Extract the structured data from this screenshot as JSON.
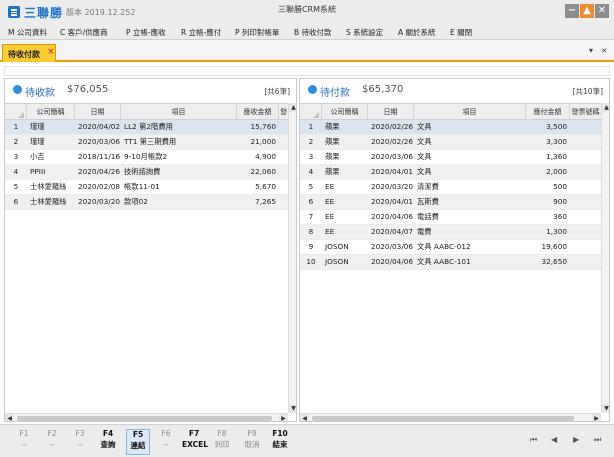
{
  "app": {
    "name": "三聯勝",
    "version": "版本 2019.12.252",
    "window_title": "三聯勝CRM系統"
  },
  "window_controls": {
    "minimize": "−",
    "maximize": "▲",
    "close": "✕"
  },
  "menu": [
    "M 公司資料",
    "C 客戶/供應商",
    "P 立帳-應收",
    "R 立帳-應付",
    "P 列印對帳單",
    "B 待收付款",
    "S 系統設定",
    "A 關於系統",
    "E 關閉"
  ],
  "tab": {
    "label": "待收付款",
    "close": "×"
  },
  "strip_controls": {
    "dropdown": "▾",
    "close": "×"
  },
  "receivable": {
    "title": "待收款",
    "amount": "$76,055",
    "count": "[共6筆]",
    "columns": [
      "公司簡稱",
      "日期",
      "項目",
      "應收金額",
      "發"
    ],
    "rows": [
      [
        "瑾瑾",
        "2020/04/02",
        "LL2 第2階費用",
        "15,760"
      ],
      [
        "瑾瑾",
        "2020/03/06",
        "TT1 第三期費用",
        "21,000"
      ],
      [
        "小吉",
        "2018/11/16",
        "9-10月帳款2",
        "4,900"
      ],
      [
        "PPIII",
        "2020/04/26",
        "技術諮詢費",
        "22,060"
      ],
      [
        "士林愛羅絲",
        "2020/02/08",
        "帳款11-01",
        "5,670"
      ],
      [
        "士林愛羅絲",
        "2020/03/20",
        "款項02",
        "7,265"
      ]
    ]
  },
  "payable": {
    "title": "待付款",
    "amount": "$65,370",
    "count": "[共10筆]",
    "columns": [
      "公司簡稱",
      "日期",
      "項目",
      "應付金額",
      "發票號碼"
    ],
    "rows": [
      [
        "蘋果",
        "2020/02/26",
        "文具",
        "3,500"
      ],
      [
        "蘋果",
        "2020/02/26",
        "文具",
        "3,300"
      ],
      [
        "蘋果",
        "2020/03/06",
        "文具",
        "1,360"
      ],
      [
        "蘋果",
        "2020/04/01",
        "文具",
        "2,000"
      ],
      [
        "EE",
        "2020/03/20",
        "清潔費",
        "500"
      ],
      [
        "EE",
        "2020/04/01",
        "瓦斯費",
        "900"
      ],
      [
        "EE",
        "2020/04/06",
        "電話費",
        "360"
      ],
      [
        "EE",
        "2020/04/07",
        "電費",
        "1,300"
      ],
      [
        "JOSON",
        "2020/03/06",
        "文具 AABC-012",
        "19,600"
      ],
      [
        "JOSON",
        "2020/04/06",
        "文具 AABC-101",
        "32,650"
      ]
    ]
  },
  "scroll_arrows": {
    "up": "▲",
    "down": "▼",
    "left": "◀",
    "right": "▶"
  },
  "fkeys": [
    {
      "key": "F1",
      "label": "--",
      "on": false
    },
    {
      "key": "F2",
      "label": "--",
      "on": false
    },
    {
      "key": "F3",
      "label": "--",
      "on": false
    },
    {
      "key": "F4",
      "label": "查詢",
      "on": true
    },
    {
      "key": "F5",
      "label": "連結",
      "on": true,
      "active": true
    },
    {
      "key": "F6",
      "label": "--",
      "on": false
    },
    {
      "key": "F7",
      "label": "EXCEL",
      "on": true
    },
    {
      "key": "F8",
      "label": "列印",
      "on": false
    },
    {
      "key": "F9",
      "label": "取消",
      "on": false
    },
    {
      "key": "F10",
      "label": "結束",
      "on": true
    }
  ],
  "pager": {
    "first": "⏮",
    "prev": "◀",
    "next": "▶",
    "last": "⏭"
  },
  "colors": {
    "accent": "#1a73c9",
    "tab": "#ffcc33",
    "tab_border": "#f2a000",
    "dot": "#2a8ee0"
  }
}
